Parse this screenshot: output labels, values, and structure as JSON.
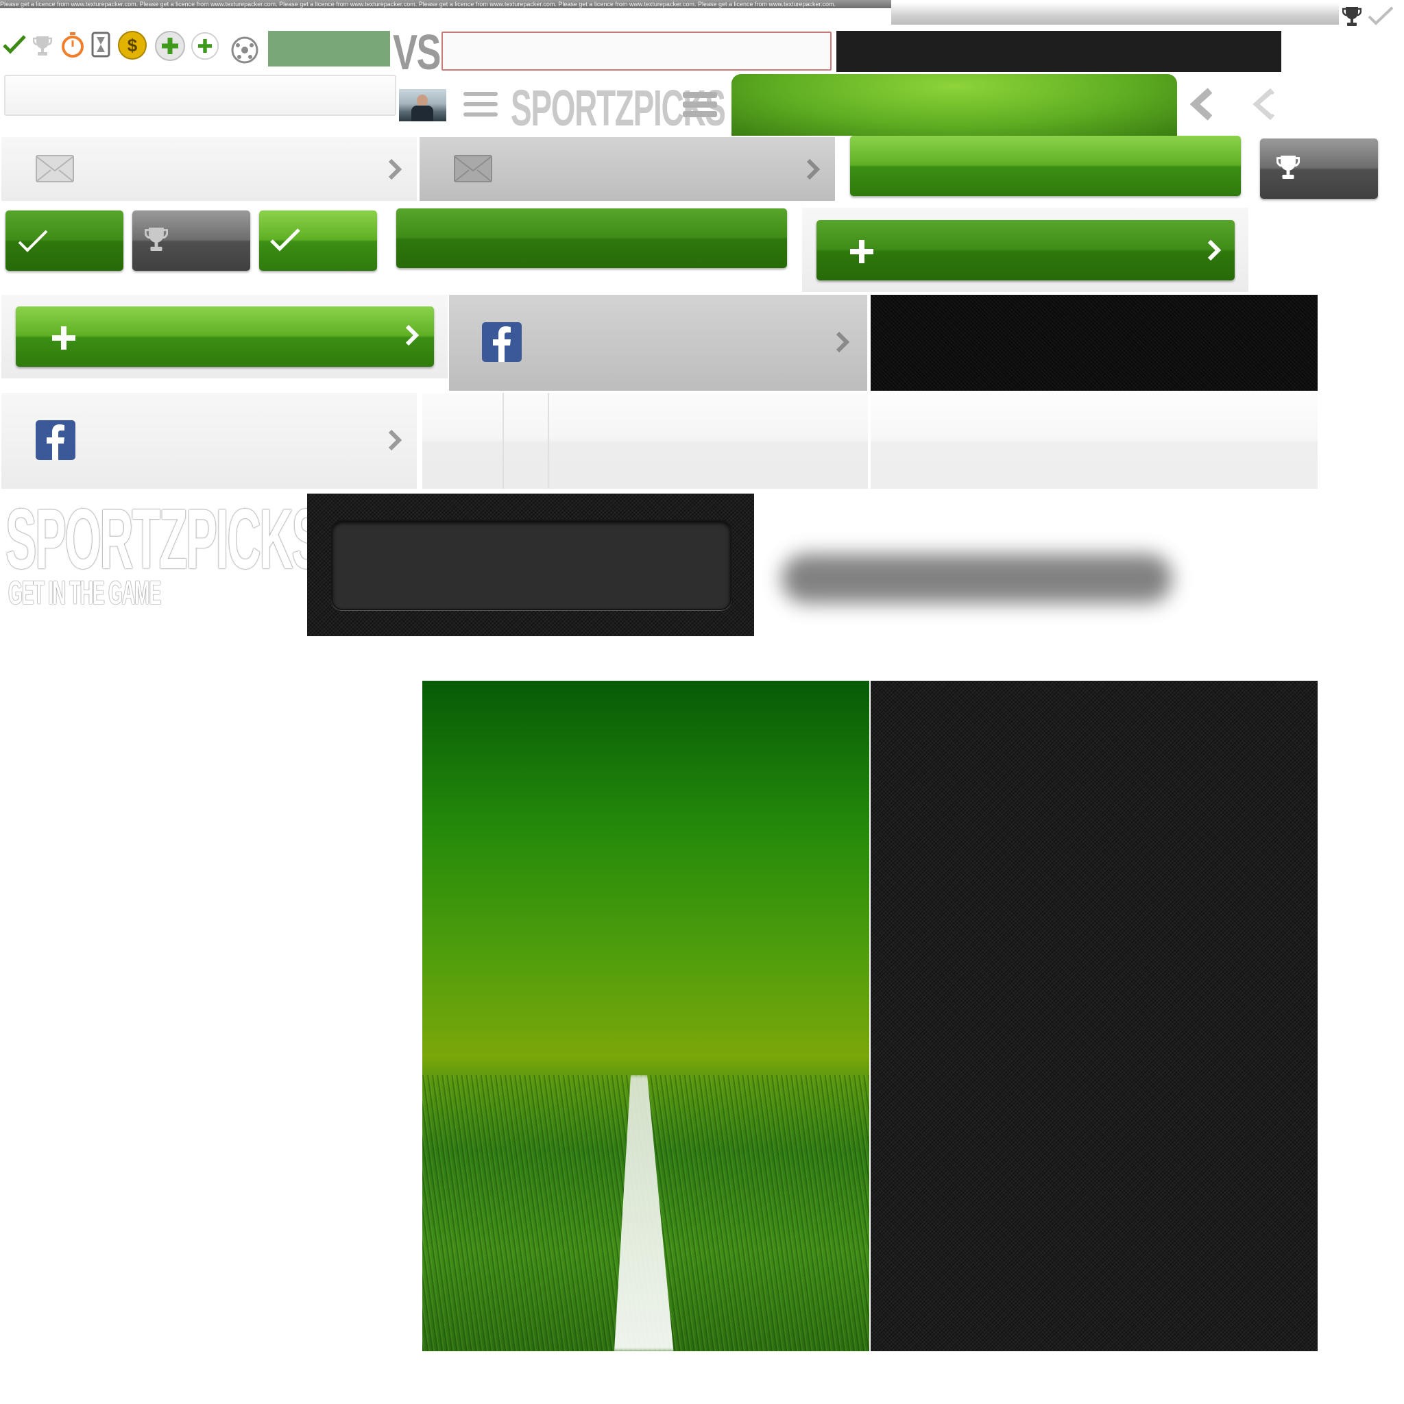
{
  "watermark": {
    "text": "Please get a licence from www.texturepacker.com. Please get a licence from www.texturepacker.com. Please get a licence from www.texturepacker.com. Please get a licence from www.texturepacker.com. Please get a licence from www.texturepacker.com. Please get a licence from www.texturepacker.com."
  },
  "header": {
    "vs_label": "VS",
    "logo_small": "SPORTZPICKS"
  },
  "logo": {
    "title": "SPORTZPICKS",
    "tagline": "GET IN THE GAME"
  },
  "colors": {
    "accent_green": "#5fb024",
    "dark_green": "#2e780c",
    "gray_button": "#4f4f4f",
    "facebook_blue": "#3b5998",
    "coin_gold": "#e2b300",
    "timer_orange": "#f07f2b",
    "input_border_red": "#c97b7b"
  },
  "icons": [
    "check-icon",
    "trophy-icon",
    "stopwatch-icon",
    "hourglass-icon",
    "coin-dollar-icon",
    "plus-circle-icon",
    "soccer-ball-icon",
    "mail-icon",
    "facebook-icon",
    "menu-icon",
    "chevron-right-icon",
    "back-arrow-icon",
    "avatar"
  ]
}
